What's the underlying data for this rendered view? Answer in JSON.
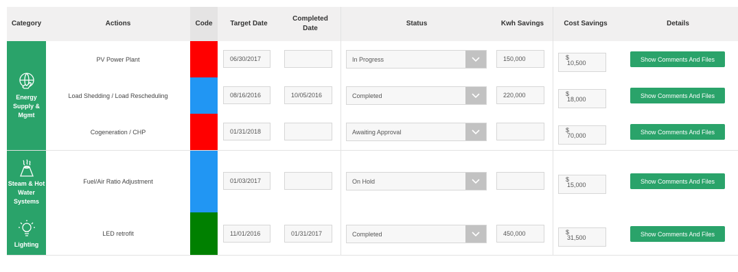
{
  "colors": {
    "accent": "#2aa36a",
    "red": "#ff0000",
    "blue": "#2196f3",
    "green": "#008000"
  },
  "headers": {
    "category": "Category",
    "actions": "Actions",
    "code": "Code",
    "target_date": "Target Date",
    "completed_date": "Completed Date",
    "status": "Status",
    "kwh_savings": "Kwh Savings",
    "cost_savings": "Cost Savings",
    "details": "Details"
  },
  "categories": [
    {
      "label": "Energy Supply & Mgmt",
      "icon": "globe-hand-icon"
    },
    {
      "label": "Steam & Hot Water Systems",
      "icon": "steam-icon"
    },
    {
      "label": "Lighting",
      "icon": "lightbulb-icon"
    }
  ],
  "currency_symbol": "$",
  "rows": [
    {
      "action": "PV Power Plant",
      "code_color": "#ff0000",
      "target_date": "06/30/2017",
      "completed_date": "",
      "status": "In Progress",
      "kwh": "150,000",
      "cost": "10,500",
      "details": "Show Comments And Files"
    },
    {
      "action": "Load Shedding / Load Rescheduling",
      "code_color": "#2196f3",
      "target_date": "08/16/2016",
      "completed_date": "10/05/2016",
      "status": "Completed",
      "kwh": "220,000",
      "cost": "18,000",
      "details": "Show Comments And Files"
    },
    {
      "action": "Cogeneration / CHP",
      "code_color": "#ff0000",
      "target_date": "01/31/2018",
      "completed_date": "",
      "status": "Awaiting Approval",
      "kwh": "",
      "cost": "70,000",
      "details": "Show Comments And Files"
    },
    {
      "action": "Fuel/Air Ratio Adjustment",
      "code_color": "#2196f3",
      "target_date": "01/03/2017",
      "completed_date": "",
      "status": "On Hold",
      "kwh": "",
      "cost": "15,000",
      "details": "Show Comments And Files"
    },
    {
      "action": "LED retrofit",
      "code_color": "#008000",
      "target_date": "11/01/2016",
      "completed_date": "01/31/2017",
      "status": "Completed",
      "kwh": "450,000",
      "cost": "31,500",
      "details": "Show Comments And Files"
    }
  ]
}
